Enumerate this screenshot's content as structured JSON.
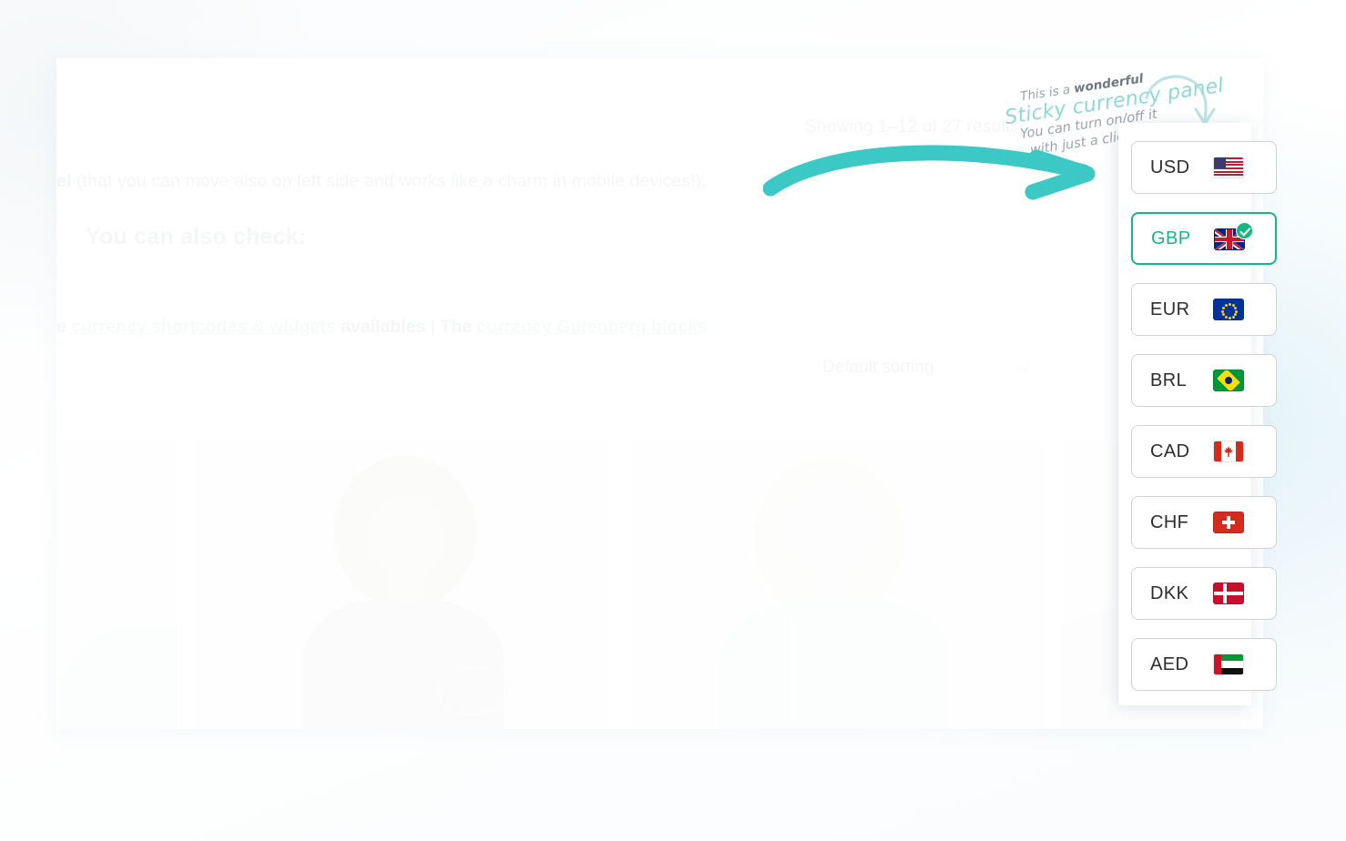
{
  "page": {
    "intro_text_visible": "el (that you can move also on left side and works like a charm in mobile devices!).",
    "intro_bold_fragment": "el",
    "intro_rest": " (that you can move also on left side and works like a charm in mobile devices!).",
    "section_heading": "You can also check:"
  },
  "links_row": {
    "lead_fragment": "e",
    "link_1": "currency shortcodes & widgets",
    "middle_text": " availables ",
    "separator": "|",
    "the_word": " The ",
    "link_2": "currency Gutenberg blocks"
  },
  "shop": {
    "result_count": "Showing 1–12 of 27 results",
    "sorting_selected": "Default sorting",
    "sorting_caret_icon": "chevron-down-icon"
  },
  "annotation": {
    "line1_plain": "This is a ",
    "line1_bold": "wonderful",
    "line2": "Sticky currency panel",
    "line3": "You can turn on/off it",
    "line4": "with just a click",
    "arrow_icon": "curved-arrow-right-icon",
    "small_arrow_icon": "curved-arrow-down-icon"
  },
  "colors": {
    "accent_teal": "#3cc8c4",
    "annotation_teal": "#8ed8d6",
    "selected_green": "#17b77f",
    "muted_text": "#c9cdd0",
    "panel_border": "#cfd2d4"
  },
  "currency_panel": {
    "name": "sticky-currency-panel",
    "selected_code": "GBP",
    "items": [
      {
        "code": "USD",
        "flag": "flag-united-states-icon",
        "selected": false
      },
      {
        "code": "GBP",
        "flag": "flag-united-kingdom-icon",
        "selected": true
      },
      {
        "code": "EUR",
        "flag": "flag-european-union-icon",
        "selected": false
      },
      {
        "code": "BRL",
        "flag": "flag-brazil-icon",
        "selected": false
      },
      {
        "code": "CAD",
        "flag": "flag-canada-icon",
        "selected": false
      },
      {
        "code": "CHF",
        "flag": "flag-switzerland-icon",
        "selected": false
      },
      {
        "code": "DKK",
        "flag": "flag-denmark-icon",
        "selected": false
      },
      {
        "code": "AED",
        "flag": "flag-united-arab-emirates-icon",
        "selected": false
      }
    ]
  },
  "products": [
    {
      "alt": "product-image-partial-left"
    },
    {
      "alt": "product-image-navy-top-model"
    },
    {
      "alt": "product-image-mint-blouse-model"
    },
    {
      "alt": "product-image-partial-right"
    }
  ]
}
